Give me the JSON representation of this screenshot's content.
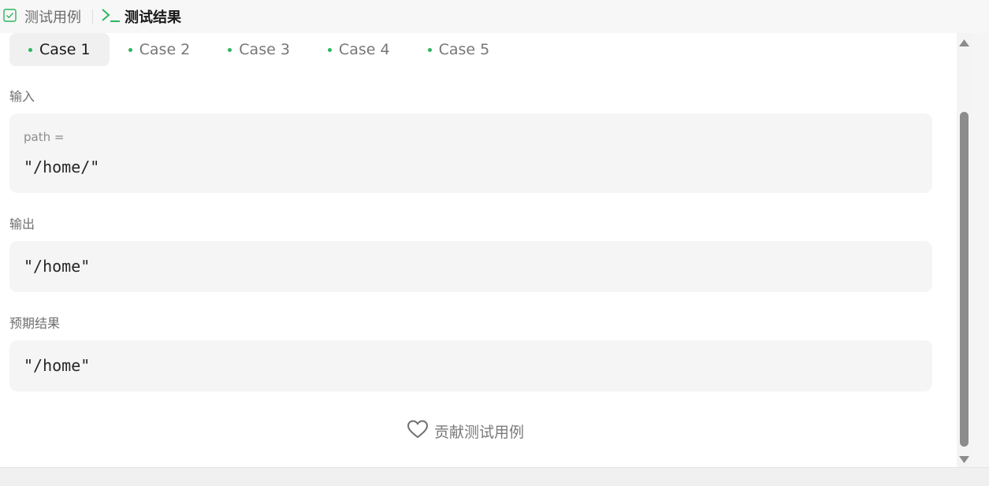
{
  "top_tabs": {
    "cases_label": "测试用例",
    "result_label": "测试结果"
  },
  "cases": [
    {
      "label": "Case 1",
      "active": true
    },
    {
      "label": "Case 2",
      "active": false
    },
    {
      "label": "Case 3",
      "active": false
    },
    {
      "label": "Case 4",
      "active": false
    },
    {
      "label": "Case 5",
      "active": false
    }
  ],
  "input": {
    "label": "输入",
    "var_name": "path =",
    "value": "\"/home/\""
  },
  "output": {
    "label": "输出",
    "value": "\"/home\""
  },
  "expected": {
    "label": "预期结果",
    "value": "\"/home\""
  },
  "contribute_label": "贡献测试用例",
  "colors": {
    "accent_green": "#2db55d",
    "code_bg": "#f5f5f5"
  },
  "icons": [
    "checkbox-icon",
    "terminal-icon",
    "heart-icon",
    "scroll-up-arrow-icon",
    "scroll-down-arrow-icon"
  ]
}
